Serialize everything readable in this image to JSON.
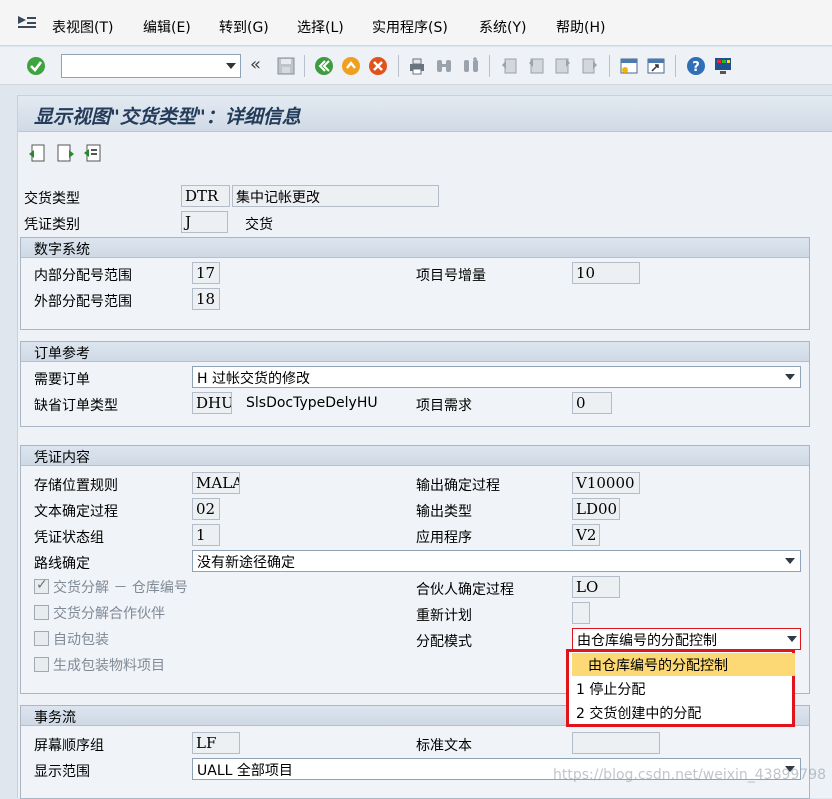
{
  "menu": [
    {
      "key": "table_view",
      "label": "表视图(T)"
    },
    {
      "key": "edit",
      "label": "编辑(E)"
    },
    {
      "key": "goto",
      "label": "转到(G)"
    },
    {
      "key": "select",
      "label": "选择(L)"
    },
    {
      "key": "utilities",
      "label": "实用程序(S)"
    },
    {
      "key": "system",
      "label": "系统(Y)"
    },
    {
      "key": "help",
      "label": "帮助(H)"
    }
  ],
  "toolbar": {
    "command_value": "",
    "back_glyph": "«"
  },
  "page_title": "显示视图\"交货类型\"：详细信息",
  "header": {
    "delivery_type_label": "交货类型",
    "delivery_type_code": "DTR",
    "delivery_type_text": "集中记帐更改",
    "doc_category_label": "凭证类别",
    "doc_category_code": "J",
    "doc_category_text": "交货"
  },
  "number_system": {
    "title": "数字系统",
    "internal_range_label": "内部分配号范围",
    "internal_range_value": "17",
    "external_range_label": "外部分配号范围",
    "external_range_value": "18",
    "item_increment_label": "项目号增量",
    "item_increment_value": "10"
  },
  "order_ref": {
    "title": "订单参考",
    "order_required_label": "需要订单",
    "order_required_value": "H 过帐交货的修改",
    "default_order_type_label": "缺省订单类型",
    "default_order_type_value": "DHU",
    "default_order_type_text": "SlsDocTypeDelyHU",
    "item_requirement_label": "项目需求",
    "item_requirement_value": "0"
  },
  "doc_content": {
    "title": "凭证内容",
    "storage_rule_label": "存储位置规则",
    "storage_rule_value": "MALA",
    "text_proc_label": "文本确定过程",
    "text_proc_value": "02",
    "status_group_label": "凭证状态组",
    "status_group_value": "1",
    "route_label": "路线确定",
    "route_value": "没有新途径确定",
    "split_wh_label": "交货分解 － 仓库编号",
    "split_partner_label": "交货分解合作伙伴",
    "auto_pack_label": "自动包装",
    "gen_pack_label": "生成包装物料项目",
    "output_proc_label": "输出确定过程",
    "output_proc_value": "V10000",
    "output_type_label": "输出类型",
    "output_type_value": "LD00",
    "application_label": "应用程序",
    "application_value": "V2",
    "partner_proc_label": "合伙人确定过程",
    "partner_proc_value": "LO",
    "reschedule_label": "重新计划",
    "reschedule_value": "",
    "alloc_mode_label": "分配模式",
    "alloc_mode_value": "由仓库编号的分配控制"
  },
  "dropdown_options": [
    "由仓库编号的分配控制",
    "1 停止分配",
    "2 交货创建中的分配"
  ],
  "trans_flow": {
    "title": "事务流",
    "screen_seq_label": "屏幕顺序组",
    "screen_seq_value": "LF",
    "std_text_label": "标准文本",
    "std_text_value": "",
    "display_range_label": "显示范围",
    "display_range_value": "UALL 全部项目"
  },
  "watermark": "https://blog.csdn.net/weixin_43899798"
}
